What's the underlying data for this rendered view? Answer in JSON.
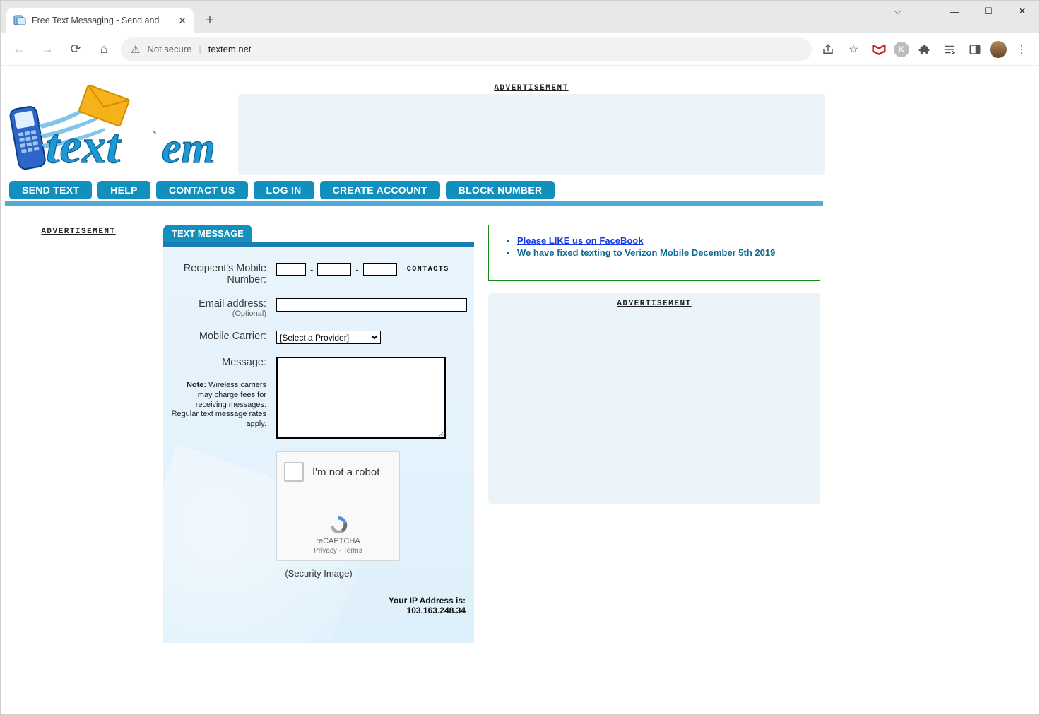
{
  "browser": {
    "tab_title": "Free Text Messaging - Send and",
    "not_secure": "Not secure",
    "url": "textem.net",
    "ext_letter": "K"
  },
  "page": {
    "ad_label": "ADVERTISEMENT",
    "nav": [
      "SEND TEXT",
      "HELP",
      "CONTACT US",
      "LOG IN",
      "CREATE ACCOUNT",
      "BLOCK NUMBER"
    ],
    "panel_title": "TEXT MESSAGE",
    "form": {
      "recipient_label": "Recipient's Mobile Number:",
      "contacts_label": "CONTACTS",
      "email_label": "Email address:",
      "email_optional": "(Optional)",
      "carrier_label": "Mobile Carrier:",
      "carrier_placeholder": "[Select a Provider]",
      "message_label": "Message:",
      "note_prefix": "Note:",
      "note_text": " Wireless carriers may charge fees for receiving messages. Regular text message rates apply.",
      "captcha_label": "I'm not a robot",
      "captcha_brand": "reCAPTCHA",
      "captcha_privacy": "Privacy",
      "captcha_terms": "Terms",
      "security_image": "(Security Image)",
      "ip_label": "Your IP Address is:",
      "ip_value": "103.163.248.34"
    },
    "announce": {
      "facebook": "Please LIKE us on FaceBook",
      "verizon": "We have fixed texting to Verizon Mobile December 5th 2019"
    }
  }
}
